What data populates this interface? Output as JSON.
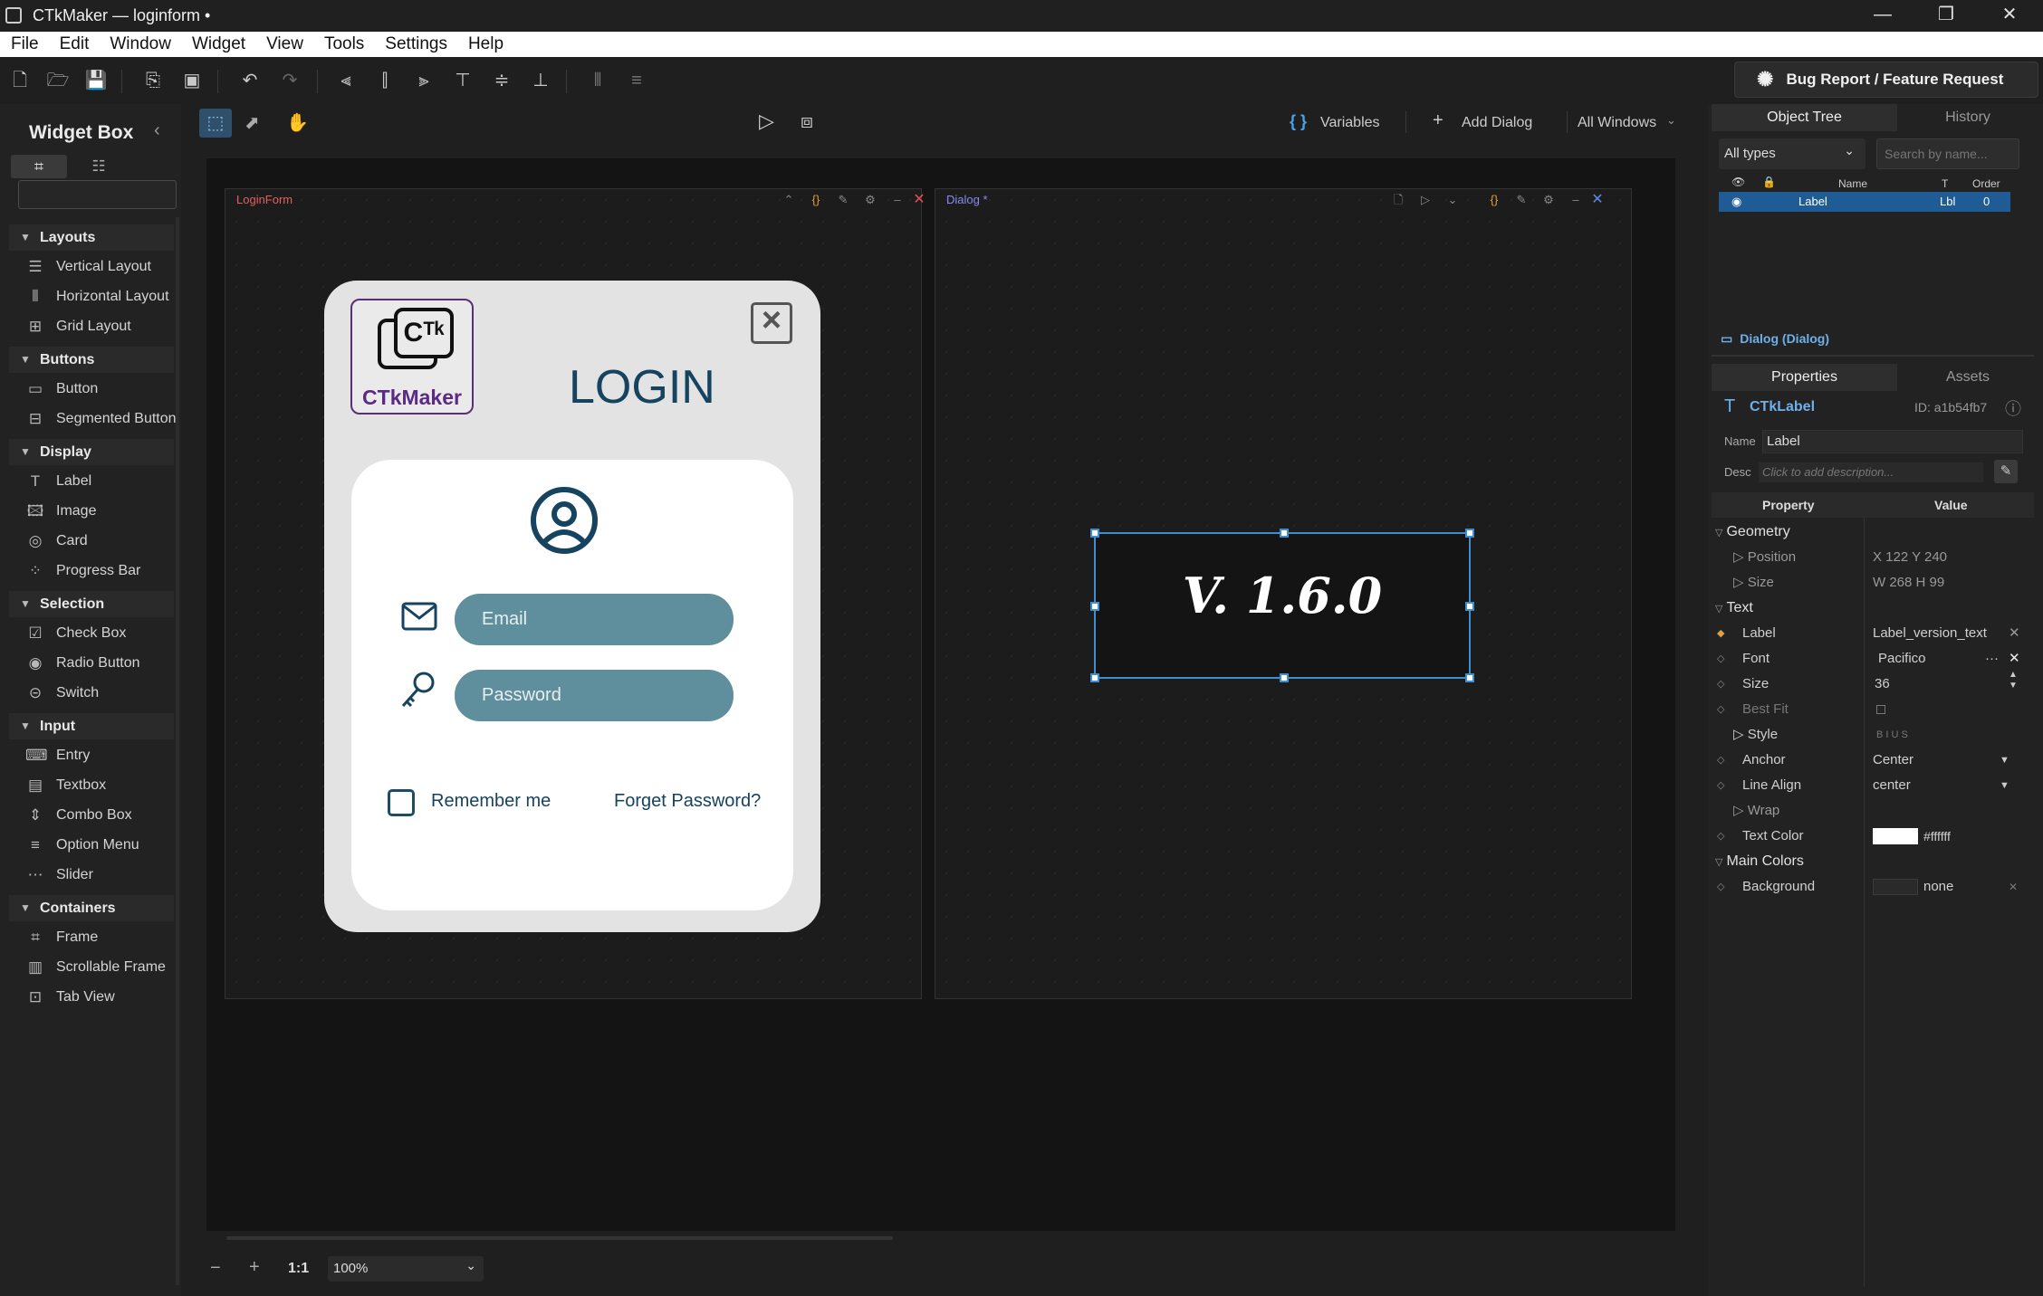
{
  "window": {
    "title": "CTkMaker — loginform •",
    "minimize": "—",
    "restore": "❐",
    "close": "✕"
  },
  "menu": [
    "File",
    "Edit",
    "Window",
    "Widget",
    "View",
    "Tools",
    "Settings",
    "Help"
  ],
  "bug_report_label": "Bug Report / Feature Request",
  "widget_box": {
    "title": "Widget Box",
    "sections": [
      {
        "label": "Layouts",
        "items": [
          {
            "label": "Vertical Layout",
            "icon": "vertical-layout-icon"
          },
          {
            "label": "Horizontal Layout",
            "icon": "horizontal-layout-icon"
          },
          {
            "label": "Grid Layout",
            "icon": "grid-layout-icon"
          }
        ]
      },
      {
        "label": "Buttons",
        "items": [
          {
            "label": "Button",
            "icon": "button-icon"
          },
          {
            "label": "Segmented Button",
            "icon": "segmented-button-icon"
          }
        ]
      },
      {
        "label": "Display",
        "items": [
          {
            "label": "Label",
            "icon": "label-icon"
          },
          {
            "label": "Image",
            "icon": "image-icon"
          },
          {
            "label": "Card",
            "icon": "card-icon"
          },
          {
            "label": "Progress Bar",
            "icon": "progress-bar-icon"
          }
        ]
      },
      {
        "label": "Selection",
        "items": [
          {
            "label": "Check Box",
            "icon": "check-box-icon"
          },
          {
            "label": "Radio Button",
            "icon": "radio-button-icon"
          },
          {
            "label": "Switch",
            "icon": "switch-icon"
          }
        ]
      },
      {
        "label": "Input",
        "items": [
          {
            "label": "Entry",
            "icon": "entry-icon"
          },
          {
            "label": "Textbox",
            "icon": "textbox-icon"
          },
          {
            "label": "Combo Box",
            "icon": "combo-box-icon"
          },
          {
            "label": "Option Menu",
            "icon": "option-menu-icon"
          },
          {
            "label": "Slider",
            "icon": "slider-icon"
          }
        ]
      },
      {
        "label": "Containers",
        "items": [
          {
            "label": "Frame",
            "icon": "frame-icon"
          },
          {
            "label": "Scrollable Frame",
            "icon": "scrollable-frame-icon"
          },
          {
            "label": "Tab View",
            "icon": "tab-view-icon"
          }
        ]
      }
    ]
  },
  "canvas_bar": {
    "variables": "Variables",
    "add_dialog": "Add Dialog",
    "all_windows": "All Windows"
  },
  "forms": {
    "login": {
      "title": "LoginForm"
    },
    "dialog": {
      "title": "Dialog *"
    }
  },
  "login_form": {
    "logo_text": "CTkMaker",
    "title": "LOGIN",
    "email_placeholder": "Email",
    "password_placeholder": "Password",
    "remember": "Remember me",
    "forget": "Forget Password?"
  },
  "version_label": "V. 1.6.0",
  "bottom_bar": {
    "one_to_one": "1:1",
    "zoom": "100%"
  },
  "right_panel": {
    "tabs_top": [
      "Object Tree",
      "History"
    ],
    "filter": "All types",
    "search_placeholder": "Search by name...",
    "tree_headers": {
      "name": "Name",
      "type": "T",
      "order": "Order"
    },
    "tree_row": {
      "name": "Label",
      "type": "Lbl",
      "order": "0"
    },
    "selected_parent": "Dialog  (Dialog)",
    "tabs_bottom": [
      "Properties",
      "Assets"
    ],
    "widget_type": "CTkLabel",
    "widget_id": "ID: a1b54fb7",
    "name_label": "Name",
    "name_value": "Label",
    "desc_label": "Desc",
    "desc_placeholder": "Click to add description...",
    "col_property": "Property",
    "col_value": "Value",
    "groups": {
      "geometry": "Geometry",
      "position": "Position",
      "position_value": "X 122  Y 240",
      "size": "Size",
      "size_value": "W 268  H 99",
      "text": "Text",
      "label": "Label",
      "label_value": "Label_version_text",
      "font": "Font",
      "font_value": "Pacifico",
      "fsize": "Size",
      "fsize_value": "36",
      "bestfit": "Best Fit",
      "style": "Style",
      "style_value": "B  I  U  S",
      "anchor": "Anchor",
      "anchor_value": "Center",
      "linealign": "Line Align",
      "linealign_value": "center",
      "wrap": "Wrap",
      "textcolor": "Text Color",
      "textcolor_value": "#ffffff",
      "maincolors": "Main Colors",
      "background": "Background",
      "background_value": "none"
    }
  },
  "colors": {
    "accent": "#3e8ed0",
    "login_title": "#154360",
    "field": "#5f8f9c",
    "logo": "#5b2a86",
    "close_red": "#e05050"
  }
}
